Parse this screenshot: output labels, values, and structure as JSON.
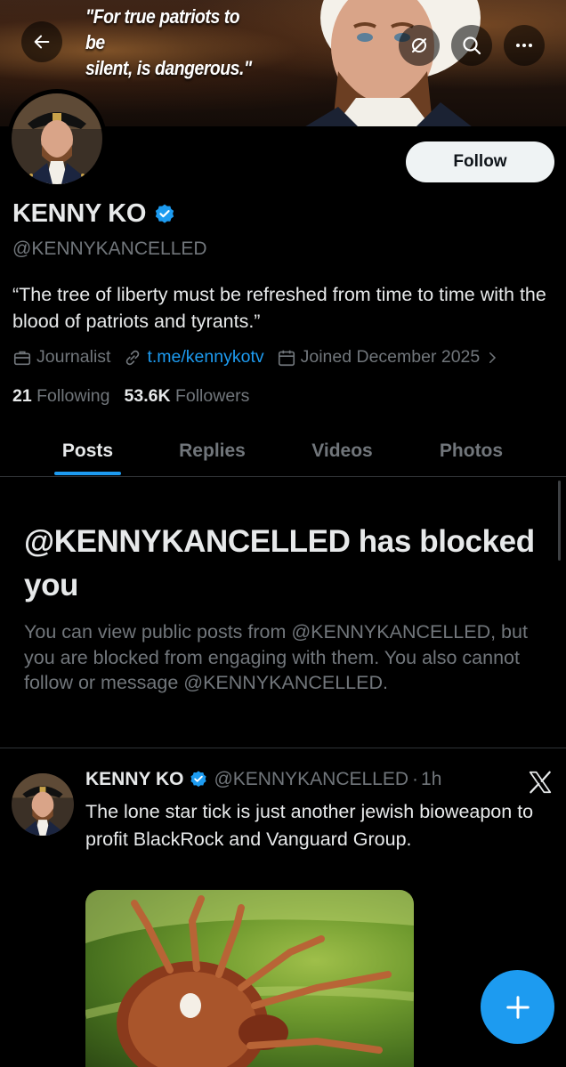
{
  "banner": {
    "quote_line1": "\"For true patriots to be",
    "quote_line2": "silent, is dangerous.\""
  },
  "header": {
    "back_icon": "arrow-left-icon",
    "grok_icon": "slashed-circle-icon",
    "search_icon": "search-icon",
    "more_icon": "more-horizontal-icon"
  },
  "profile": {
    "follow_label": "Follow",
    "name": "KENNY KO",
    "verified_icon": "verified-badge-icon",
    "handle": "@KENNYKANCELLED",
    "bio": "“The tree of liberty must be refreshed from time to time with the blood of patriots and tyrants.”",
    "profession": "Journalist",
    "link": "t.me/kennykotv",
    "joined": "Joined December 2025",
    "following_count": "21",
    "following_label": "Following",
    "followers_count": "53.6K",
    "followers_label": "Followers"
  },
  "tabs": [
    {
      "label": "Posts",
      "active": true
    },
    {
      "label": "Replies",
      "active": false
    },
    {
      "label": "Videos",
      "active": false
    },
    {
      "label": "Photos",
      "active": false
    }
  ],
  "blocked": {
    "title": "@KENNYKANCELLED has blocked you",
    "description": "You can view public posts from @KENNYKANCELLED, but you are blocked from engaging with them. You also cannot follow or message @KENNYKANCELLED."
  },
  "post": {
    "name": "KENNY KO",
    "handle": "@KENNYKANCELLED",
    "separator": "·",
    "time": "1h",
    "text": "The lone star tick is just another jewish bioweapon to profit BlackRock and Vanguard Group.",
    "source_icon": "x-logo-icon"
  },
  "fab": {
    "icon": "plus-icon"
  },
  "colors": {
    "accent": "#1d9bf0",
    "background": "#000000",
    "text_primary": "#e7e9ea",
    "text_secondary": "#71767b",
    "divider": "#2f3336"
  }
}
